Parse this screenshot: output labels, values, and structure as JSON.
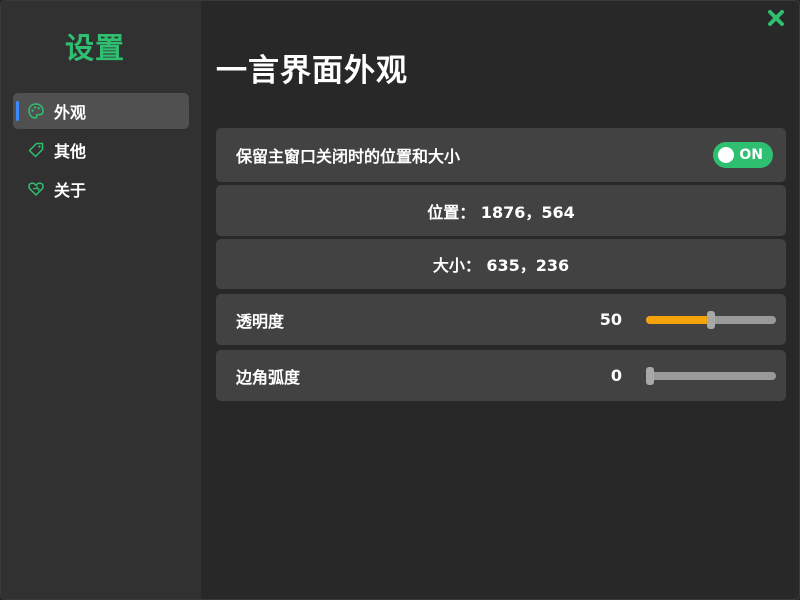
{
  "sidebar": {
    "title": "设置",
    "items": [
      {
        "label": "外观",
        "icon": "palette-icon",
        "active": true
      },
      {
        "label": "其他",
        "icon": "tag-icon",
        "active": false
      },
      {
        "label": "关于",
        "icon": "heart-icon",
        "active": false
      }
    ]
  },
  "main": {
    "title": "一言界面外观",
    "remember_window": {
      "label": "保留主窗口关闭时的位置和大小",
      "toggle_label": "ON",
      "enabled": true
    },
    "position_text": "位置： 1876，564",
    "size_text": "大小： 635，236",
    "opacity": {
      "label": "透明度",
      "value": "50",
      "level": 0.5
    },
    "corner_radius": {
      "label": "边角弧度",
      "value": "0",
      "level": 0
    }
  },
  "window": {
    "close_icon": "close-icon"
  },
  "colors": {
    "accent_green": "#2fbf71",
    "slider_orange": "#f5a30a",
    "active_indicator": "#3d8bff",
    "card_bg": "#424242",
    "sidebar_bg": "#313131",
    "content_bg": "#282828"
  }
}
